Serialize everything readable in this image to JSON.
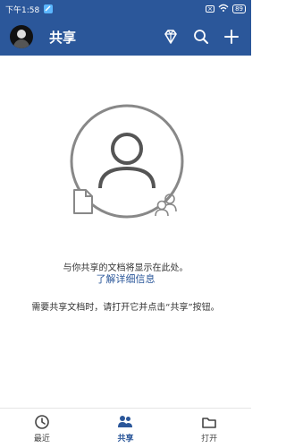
{
  "status_bar": {
    "time": "下午1:58",
    "battery": "89"
  },
  "app_bar": {
    "title": "共享",
    "actions": [
      {
        "name": "premium-icon"
      },
      {
        "name": "search-icon"
      },
      {
        "name": "plus-icon"
      }
    ]
  },
  "empty_state": {
    "message": "与你共享的文档将显示在此处。",
    "learn_more": "了解详细信息",
    "hint": "需要共享文档时，请打开它并点击“共享”按钮。"
  },
  "bottom_nav": {
    "items": [
      {
        "label": "最近",
        "icon": "clock-icon"
      },
      {
        "label": "共享",
        "icon": "people-icon",
        "active": true
      },
      {
        "label": "打开",
        "icon": "folder-icon"
      }
    ]
  },
  "colors": {
    "brand": "#2b579a",
    "text": "#333333",
    "muted": "#444444"
  }
}
